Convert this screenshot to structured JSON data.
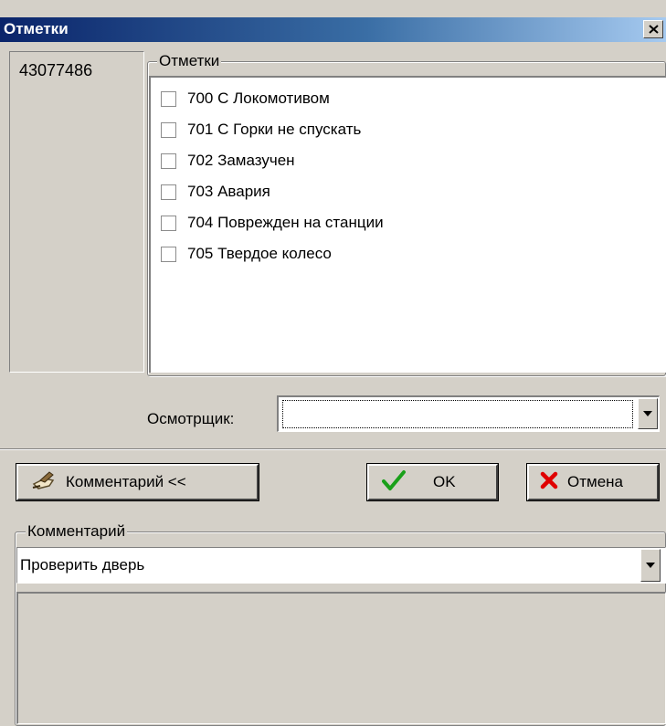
{
  "window": {
    "title": "Отметки"
  },
  "left_panel": {
    "number": "43077486"
  },
  "marks": {
    "group_label": "Отметки",
    "items": [
      {
        "label": "700 С Локомотивом",
        "checked": false
      },
      {
        "label": "701 С Горки не спускать",
        "checked": false
      },
      {
        "label": "702 Замазучен",
        "checked": false
      },
      {
        "label": "703 Авария",
        "checked": false
      },
      {
        "label": "704 Поврежден на станции",
        "checked": false
      },
      {
        "label": "705 Твердое колесо",
        "checked": false
      }
    ]
  },
  "inspector": {
    "label": "Осмотрщик:",
    "value": ""
  },
  "buttons": {
    "comment": {
      "label": "Комментарий <<",
      "icon": "writing-hand-icon"
    },
    "ok": {
      "label": "OK",
      "icon": "checkmark-icon"
    },
    "cancel": {
      "label": "Отмена",
      "icon": "x-icon"
    }
  },
  "comment": {
    "group_label": "Комментарий",
    "value": "Проверить дверь",
    "text": ""
  },
  "colors": {
    "titlebar_start": "#0a246a",
    "titlebar_end": "#a6caf0",
    "face": "#d4d0c8",
    "ok_check": "#1aa01a",
    "cancel_x": "#e00000"
  }
}
